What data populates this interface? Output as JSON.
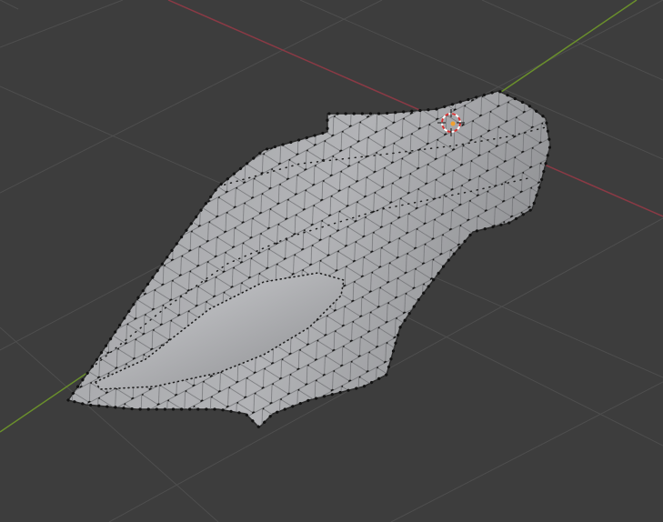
{
  "viewport": {
    "background": "#3d3d3d",
    "grid_color": "#4e4e4e",
    "x_axis_color": "#8a3a45",
    "y_axis_color": "#6a8f2c",
    "mesh_color": "#a9aaad",
    "mesh_shade": "#8e8f92",
    "vertex_color": "#111111",
    "cursor_color": "#d43030"
  }
}
